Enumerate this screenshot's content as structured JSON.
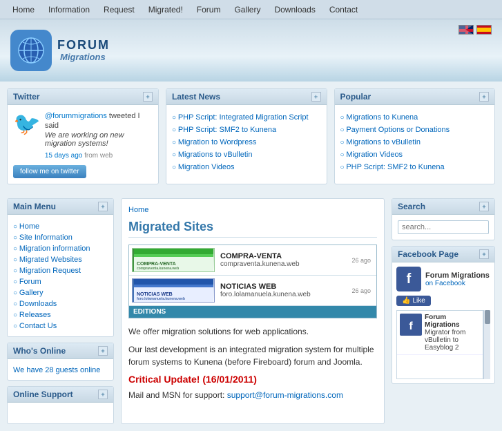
{
  "navbar": {
    "items": [
      {
        "label": "Home",
        "href": "#"
      },
      {
        "label": "Information",
        "href": "#"
      },
      {
        "label": "Request",
        "href": "#"
      },
      {
        "label": "Migrated!",
        "href": "#"
      },
      {
        "label": "Forum",
        "href": "#"
      },
      {
        "label": "Gallery",
        "href": "#"
      },
      {
        "label": "Downloads",
        "href": "#"
      },
      {
        "label": "Contact",
        "href": "#"
      }
    ]
  },
  "header": {
    "logo_line1": "FORUM",
    "logo_line2": "Migrations"
  },
  "twitter_widget": {
    "title": "Twitter",
    "tweet_user": "@forummigrations",
    "tweet_text": " tweeted I said",
    "tweet_body": "We are working on new migration systems!",
    "tweet_link": "15 days ago",
    "tweet_from": " from web",
    "follow_label": "follow me on twitter"
  },
  "latest_news_widget": {
    "title": "Latest News",
    "items": [
      {
        "label": "PHP Script: Integrated Migration Script",
        "href": "#"
      },
      {
        "label": "PHP Script: SMF2 to Kunena",
        "href": "#"
      },
      {
        "label": "Migration to Wordpress",
        "href": "#"
      },
      {
        "label": "Migrations to vBulletin",
        "href": "#"
      },
      {
        "label": "Migration Videos",
        "href": "#"
      }
    ]
  },
  "popular_widget": {
    "title": "Popular",
    "items": [
      {
        "label": "Migrations to Kunena",
        "href": "#"
      },
      {
        "label": "Payment Options or Donations",
        "href": "#"
      },
      {
        "label": "Migrations to vBulletin",
        "href": "#"
      },
      {
        "label": "Migration Videos",
        "href": "#"
      },
      {
        "label": "PHP Script: SMF2 to Kunena",
        "href": "#"
      }
    ]
  },
  "sidebar_main_menu": {
    "title": "Main Menu",
    "items": [
      {
        "label": "Home"
      },
      {
        "label": "Site Information"
      },
      {
        "label": "Migration information"
      },
      {
        "label": "Migrated Websites"
      },
      {
        "label": "Migration Request"
      },
      {
        "label": "Forum"
      },
      {
        "label": "Gallery"
      },
      {
        "label": "Downloads"
      },
      {
        "label": "Releases"
      },
      {
        "label": "Contact Us"
      }
    ]
  },
  "sidebar_whos_online": {
    "title": "Who's Online",
    "text": "We have 28 guests online"
  },
  "sidebar_online_support": {
    "title": "Online Support"
  },
  "center": {
    "breadcrumb": "Home",
    "page_title": "Migrated Sites",
    "gallery_items": [
      {
        "name": "COMPRA-VENTA",
        "desc": "compraventa.kunena.web",
        "date": "26 ago"
      },
      {
        "name": "NOTICIAS WEB",
        "desc": "foro.lolamanuela.kunena.web",
        "date": "26 ago"
      }
    ],
    "gallery_footer": "EDITIONS",
    "content1": "We offer migration solutions for web applications.",
    "content2": "Our last development is an integrated migration system for multiple forum systems to Kunena (before Fireboard) forum and Joomla.",
    "critical_update": "Critical Update! (16/01/2011)",
    "support_text": "Mail and MSN for support:",
    "support_email": "support@forum-migrations.com"
  },
  "search_widget": {
    "title": "Search",
    "placeholder": "search..."
  },
  "facebook_widget": {
    "title": "Facebook Page",
    "page_name": "Forum Migrations",
    "page_sub": "on Facebook",
    "like_label": "Like",
    "scroll_item1_name": "Forum Migrations",
    "scroll_item1_text": "Migrator from vBulletin to Easyblog 2"
  }
}
